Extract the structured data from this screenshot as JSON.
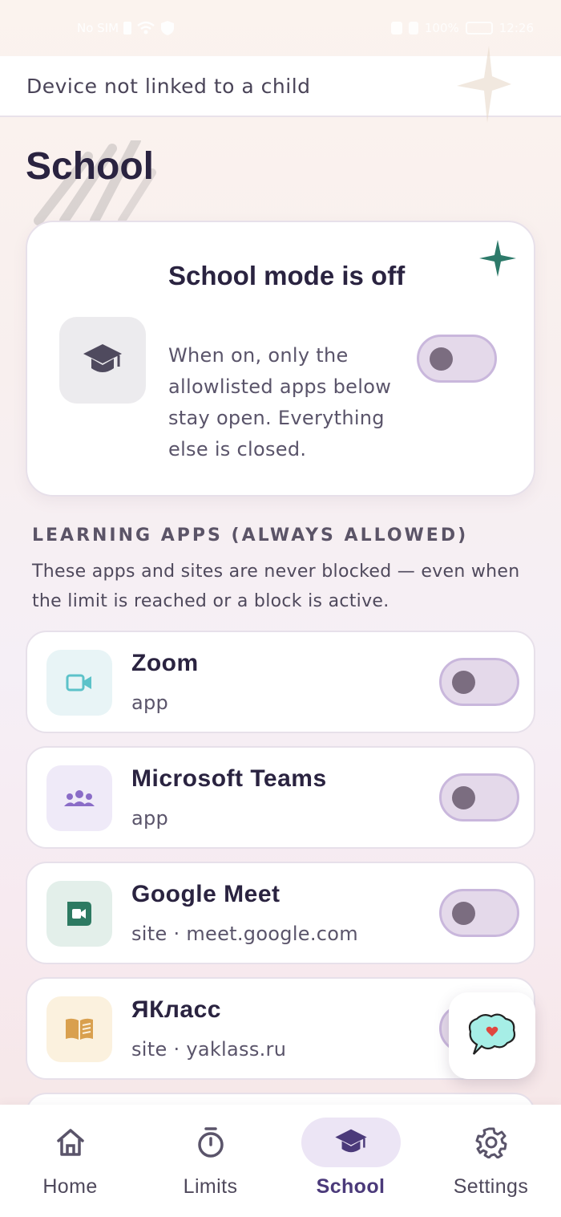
{
  "status_bar": {
    "carrier": "No SIM",
    "battery_percent": "100%",
    "time": "12:26"
  },
  "banner": {
    "text": "Device not linked to a child"
  },
  "page": {
    "title": "School"
  },
  "school_mode": {
    "title": "School mode is off",
    "description": "When on, only the allowlisted apps below stay open. Everything else is closed.",
    "enabled": false,
    "icon": "graduation-cap-icon"
  },
  "learning_apps": {
    "heading": "LEARNING APPS (ALWAYS ALLOWED)",
    "description": "These apps and sites are never blocked — even when the limit is reached or a block is active.",
    "items": [
      {
        "name": "Zoom",
        "subtitle": "app",
        "icon": "video-camera-icon",
        "icon_bg": "#e8f4f6",
        "icon_color": "#5cc2c9",
        "enabled": false
      },
      {
        "name": "Microsoft Teams",
        "subtitle": "app",
        "icon": "group-icon",
        "icon_bg": "#efeaf8",
        "icon_color": "#8a6cc7",
        "enabled": false
      },
      {
        "name": "Google Meet",
        "subtitle": "site · meet.google.com",
        "icon": "google-meet-icon",
        "icon_bg": "#e3efea",
        "icon_color": "#2d7a62",
        "enabled": false
      },
      {
        "name": "ЯКласс",
        "subtitle": "site · yaklass.ru",
        "icon": "book-icon",
        "icon_bg": "#fbf1de",
        "icon_color": "#d9a04e",
        "enabled": false
      }
    ]
  },
  "nav": {
    "items": [
      {
        "label": "Home",
        "icon": "home-icon"
      },
      {
        "label": "Limits",
        "icon": "timer-icon"
      },
      {
        "label": "School",
        "icon": "graduation-cap-icon",
        "active": true
      },
      {
        "label": "Settings",
        "icon": "gear-icon"
      }
    ]
  },
  "colors": {
    "accent": "#4b3a7a",
    "toggle_track": "#e4d9ea",
    "toggle_border": "#c9b7dc",
    "toggle_knob": "#7b6d80"
  }
}
